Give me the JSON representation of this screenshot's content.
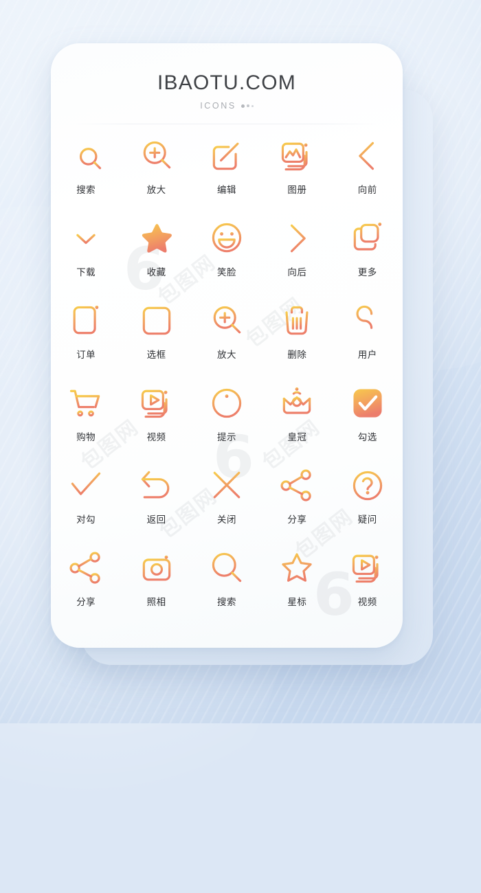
{
  "header": {
    "title": "IBAOTU.COM",
    "subtitle": "ICONS"
  },
  "palette": {
    "gradient_start": "#F6C94A",
    "gradient_mid": "#F2A85C",
    "gradient_end": "#EE8169",
    "label_color": "#2F3135",
    "card_background": "#FFFFFF",
    "page_background": "#DBE7F6"
  },
  "grid": {
    "columns": 5,
    "rows": 6,
    "icons": [
      {
        "label": "搜索",
        "icon": "search-list-icon"
      },
      {
        "label": "放大",
        "icon": "zoom-in-icon"
      },
      {
        "label": "编辑",
        "icon": "edit-pencil-icon"
      },
      {
        "label": "图册",
        "icon": "album-icon"
      },
      {
        "label": "向前",
        "icon": "chevron-left-icon"
      },
      {
        "label": "下载",
        "icon": "download-icon"
      },
      {
        "label": "收藏",
        "icon": "star-filled-icon"
      },
      {
        "label": "笑脸",
        "icon": "smiley-icon"
      },
      {
        "label": "向后",
        "icon": "chevron-right-icon"
      },
      {
        "label": "更多",
        "icon": "copy-layers-icon"
      },
      {
        "label": "订单",
        "icon": "order-document-icon"
      },
      {
        "label": "选框",
        "icon": "checkbox-empty-icon"
      },
      {
        "label": "放大",
        "icon": "magnifier-plus-icon"
      },
      {
        "label": "删除",
        "icon": "trash-icon"
      },
      {
        "label": "用户",
        "icon": "user-icon"
      },
      {
        "label": "购物",
        "icon": "shopping-cart-icon"
      },
      {
        "label": "视频",
        "icon": "video-play-icon"
      },
      {
        "label": "提示",
        "icon": "info-circle-icon"
      },
      {
        "label": "皇冠",
        "icon": "crown-icon"
      },
      {
        "label": "勾选",
        "icon": "check-filled-icon"
      },
      {
        "label": "对勾",
        "icon": "check-icon"
      },
      {
        "label": "返回",
        "icon": "undo-arrow-icon"
      },
      {
        "label": "关闭",
        "icon": "close-x-icon"
      },
      {
        "label": "分享",
        "icon": "share-nodes-icon"
      },
      {
        "label": "疑问",
        "icon": "question-circle-icon"
      },
      {
        "label": "分享",
        "icon": "share-nodes-icon"
      },
      {
        "label": "照相",
        "icon": "camera-icon"
      },
      {
        "label": "搜索",
        "icon": "magnifier-icon"
      },
      {
        "label": "星标",
        "icon": "star-outline-icon"
      },
      {
        "label": "视频",
        "icon": "video-play-icon"
      }
    ]
  },
  "watermarks": [
    {
      "text": "6"
    },
    {
      "text": "包图网"
    }
  ]
}
